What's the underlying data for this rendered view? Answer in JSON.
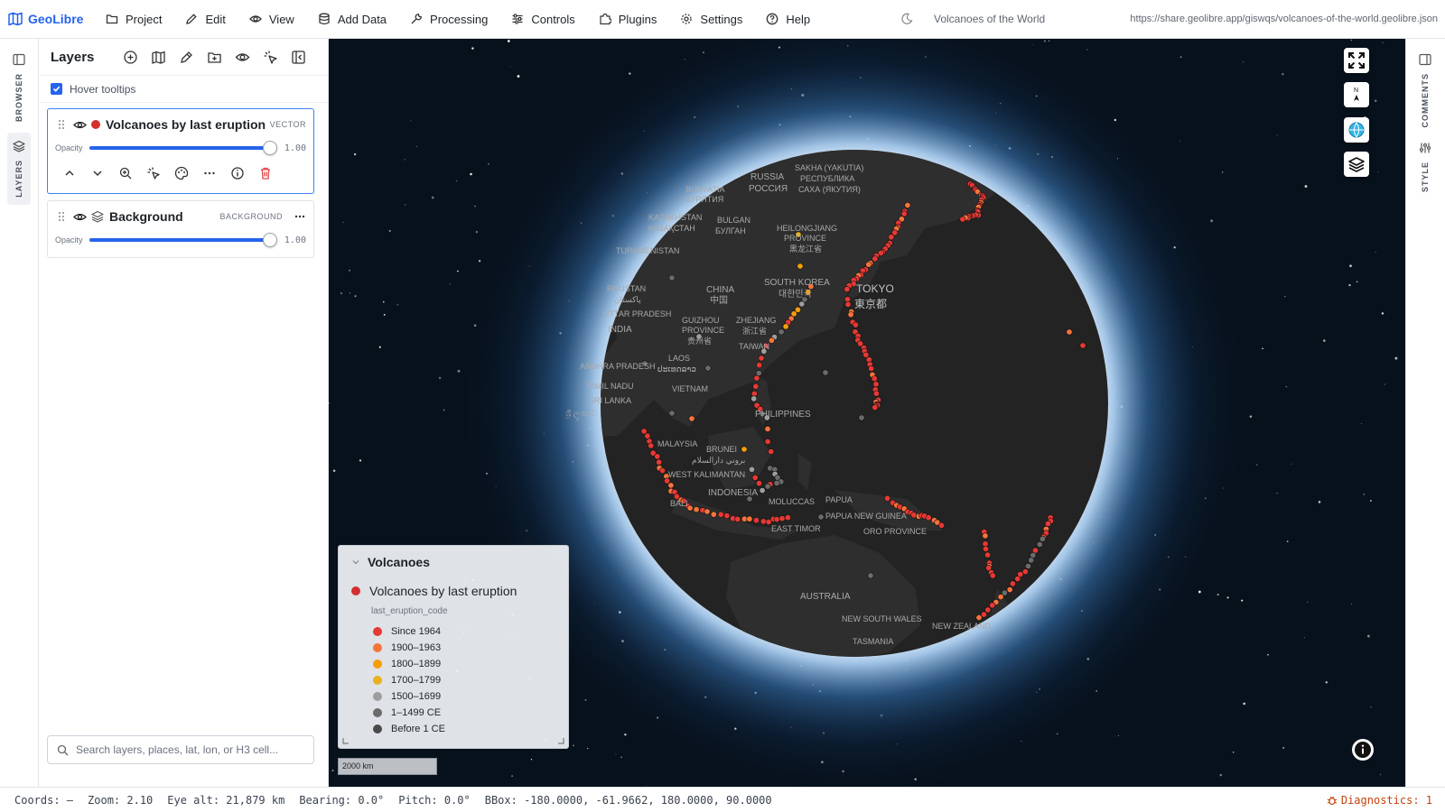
{
  "app": {
    "name": "GeoLibre"
  },
  "menu": [
    "Project",
    "Edit",
    "View",
    "Add Data",
    "Processing",
    "Controls",
    "Plugins",
    "Settings",
    "Help"
  ],
  "project": {
    "title": "Volcanoes of the World",
    "url": "https://share.geolibre.app/giswqs/volcanoes-of-the-world.geolibre.json"
  },
  "left_rail": {
    "browser": "BROWSER",
    "layers": "LAYERS"
  },
  "right_rail": {
    "comments": "COMMENTS",
    "style": "STYLE"
  },
  "layers_panel": {
    "title": "Layers",
    "hover_tooltips": "Hover tooltips",
    "search_placeholder": "Search layers, places, lat, lon, or H3 cell...",
    "layers": [
      {
        "name": "Volcanoes by last eruption",
        "type": "VECTOR",
        "opacity_label": "Opacity",
        "opacity": "1.00",
        "color": "#d32f2f"
      },
      {
        "name": "Background",
        "type": "BACKGROUND",
        "opacity_label": "Opacity",
        "opacity": "1.00"
      }
    ]
  },
  "legend": {
    "title": "Volcanoes",
    "layer": "Volcanoes by last eruption",
    "field": "last_eruption_code",
    "items": [
      {
        "label": "Since 1964",
        "color": "#e53935"
      },
      {
        "label": "1900–1963",
        "color": "#f4743b"
      },
      {
        "label": "1800–1899",
        "color": "#f59e0b"
      },
      {
        "label": "1700–1799",
        "color": "#e8b020"
      },
      {
        "label": "1500–1699",
        "color": "#9e9e9e"
      },
      {
        "label": "1–1499 CE",
        "color": "#6b6b6b"
      },
      {
        "label": "Before 1 CE",
        "color": "#4a4a4a"
      }
    ]
  },
  "map": {
    "scale": "2000 km",
    "labels": [
      "RUSSIA",
      "РОССИЯ",
      "SAKHA (YAKUTIA)",
      "РЕСПУБЛИКА",
      "САХА (ЯКУТИЯ)",
      "BURYATIA",
      "БУРЯТИЯ",
      "KAZAKHSTAN",
      "ҚАЗАҚСТАН",
      "BULGAN",
      "БУЛГАН",
      "HEILONGJIANG",
      "PROVINCE",
      "黑龙江省",
      "TURKMENISTAN",
      "PAKISTAN",
      "پاکستان",
      "CHINA",
      "中国",
      "SOUTH KOREA",
      "대한민국",
      "TOKYO",
      "東京都",
      "UTTAR PRADESH",
      "INDIA",
      "GUIZHOU",
      "PROVINCE",
      "贵州省",
      "ZHEJIANG",
      "浙江省",
      "TAIWAN",
      "LAOS",
      "ປະເທດລາວ",
      "ANDHRA PRADESH",
      "VIETNAM",
      "TAMIL NADU",
      "SRI LANKA",
      "ශ්‍රී ලංකාව",
      "PHILIPPINES",
      "MALAYSIA",
      "BRUNEI",
      "بروني دارالسلام",
      "WEST KALIMANTAN",
      "INDONESIA",
      "MOLUCCAS",
      "PAPUA",
      "PAPUA NEW GUINEA",
      "ORO PROVINCE",
      "BALI",
      "EAST TIMOR",
      "AUSTRALIA",
      "NEW SOUTH WALES",
      "TASMANIA",
      "NEW ZEALAND"
    ]
  },
  "status": {
    "coords": "Coords: —",
    "zoom": "Zoom: 2.10",
    "eye_alt": "Eye alt: 21,879 km",
    "bearing": "Bearing: 0.0°",
    "pitch": "Pitch: 0.0°",
    "bbox": "BBox: -180.0000, -61.9662, 180.0000, 90.0000",
    "diagnostics": "Diagnostics: 1"
  }
}
